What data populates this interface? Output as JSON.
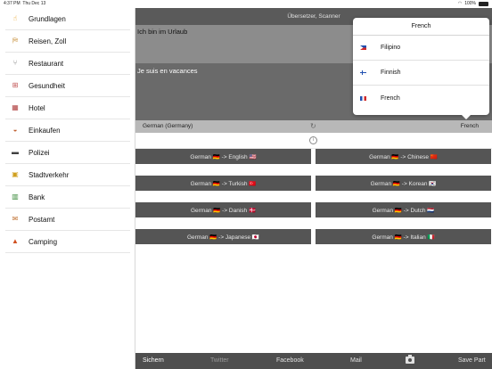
{
  "status_bar": {
    "time": "4:37 PM",
    "date": "Thu Dec 13",
    "battery": "100%"
  },
  "sidebar": {
    "items": [
      {
        "label": "Grundlagen",
        "icon": "hand-icon",
        "glyph": "☝",
        "color": "#e8a020"
      },
      {
        "label": "Reisen, Zoll",
        "icon": "passport-icon",
        "glyph": "⛿",
        "color": "#c08020"
      },
      {
        "label": "Restaurant",
        "icon": "cutlery-icon",
        "glyph": "⑂",
        "color": "#888888"
      },
      {
        "label": "Gesundheit",
        "icon": "hospital-icon",
        "glyph": "⊞",
        "color": "#c05050"
      },
      {
        "label": "Hotel",
        "icon": "hotel-icon",
        "glyph": "▦",
        "color": "#b04040"
      },
      {
        "label": "Einkaufen",
        "icon": "basket-icon",
        "glyph": "◒",
        "color": "#c06030"
      },
      {
        "label": "Polizei",
        "icon": "police-car-icon",
        "glyph": "▬",
        "color": "#404040"
      },
      {
        "label": "Stadtverkehr",
        "icon": "bus-icon",
        "glyph": "▣",
        "color": "#d0a020"
      },
      {
        "label": "Bank",
        "icon": "bank-icon",
        "glyph": "▥",
        "color": "#3a8a3a"
      },
      {
        "label": "Postamt",
        "icon": "post-office-icon",
        "glyph": "✉",
        "color": "#c07030"
      },
      {
        "label": "Camping",
        "icon": "tent-icon",
        "glyph": "▲",
        "color": "#d05020"
      }
    ]
  },
  "header": {
    "title": "Übersetzer, Scanner"
  },
  "translation": {
    "source_text": "Ich bin im Urlaub",
    "target_text": "Je suis en vacances",
    "source_language": "German (Germany)",
    "target_language": "French"
  },
  "dropdown": {
    "title": "French",
    "options": [
      {
        "label": "Filipino",
        "flag": "philippines-flag-icon"
      },
      {
        "label": "Finnish",
        "flag": "finland-flag-icon"
      },
      {
        "label": "French",
        "flag": "france-flag-icon"
      }
    ]
  },
  "pairs": [
    {
      "text": "German 🇩🇪 -> English 🇺🇸"
    },
    {
      "text": "German 🇩🇪 -> Chinese 🇨🇳"
    },
    {
      "text": "German 🇩🇪 -> Turkish 🇹🇷"
    },
    {
      "text": "German 🇩🇪 -> Korean 🇰🇷"
    },
    {
      "text": "German 🇩🇪 -> Danish 🇩🇰"
    },
    {
      "text": "German 🇩🇪 -> Dutch 🇳🇱"
    },
    {
      "text": "German 🇩🇪 -> Japanese 🇯🇵"
    },
    {
      "text": "German 🇩🇪 -> Italian 🇮🇹"
    }
  ],
  "toolbar": {
    "save": "Sichern",
    "twitter": "Twitter",
    "facebook": "Facebook",
    "mail": "Mail",
    "camera": "camera-icon",
    "save_part": "Save Part"
  }
}
